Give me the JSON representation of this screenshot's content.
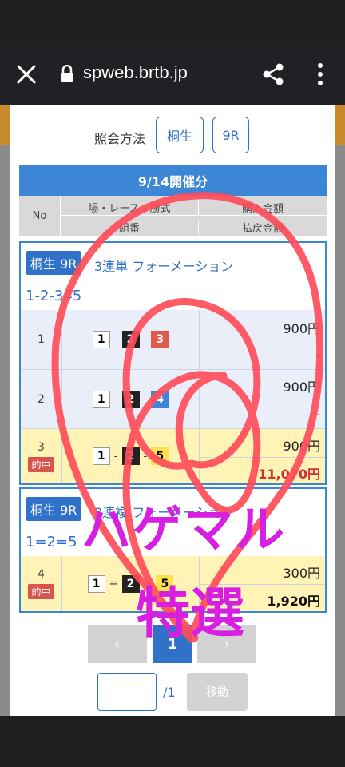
{
  "browser": {
    "url": "spweb.brtb.jp"
  },
  "query": {
    "label": "照会方法",
    "venue_button": "桐生",
    "race_button": "9R"
  },
  "table": {
    "date_header": "9/14開催分",
    "col_no": "No",
    "col_venue_race_type": "場・レース・勝式",
    "col_combination": "組番",
    "col_purchase": "購入金額",
    "col_payout": "払戻金額"
  },
  "cards": [
    {
      "venue_race": "桐生 9R",
      "bet_type": "3連単 フォーメーション",
      "combo": "1-2-345",
      "rows": [
        {
          "no": "1",
          "nums": [
            "1",
            "2",
            "3"
          ],
          "purchase": "900円",
          "payout": "-",
          "hit": false
        },
        {
          "no": "2",
          "nums": [
            "1",
            "2",
            "4"
          ],
          "purchase": "900円",
          "payout": "-",
          "hit": false
        },
        {
          "no": "3",
          "nums": [
            "1",
            "2",
            "5"
          ],
          "purchase": "900円",
          "payout": "11,070円",
          "hit": true,
          "hit_label": "的中"
        }
      ]
    },
    {
      "venue_race": "桐生 9R",
      "bet_type": "3連複 フォーメーション",
      "combo": "1=2=5",
      "rows": [
        {
          "no": "4",
          "nums": [
            "1",
            "2",
            "5"
          ],
          "purchase": "300円",
          "payout": "1,920円",
          "hit": true,
          "hit_label": "的中"
        }
      ]
    }
  ],
  "pagination": {
    "prev": "‹",
    "current": "1",
    "next": "›",
    "total": "/1",
    "move": "移動"
  },
  "overlay": {
    "line1": "ハゲマル",
    "line2": "特選"
  },
  "colors": {
    "accent": "#2f72c8",
    "hit_bg": "#fff3b5",
    "payout": "#d32f2f",
    "overlay_text": "#d61fe0",
    "scribble": "#ff4d5a"
  }
}
